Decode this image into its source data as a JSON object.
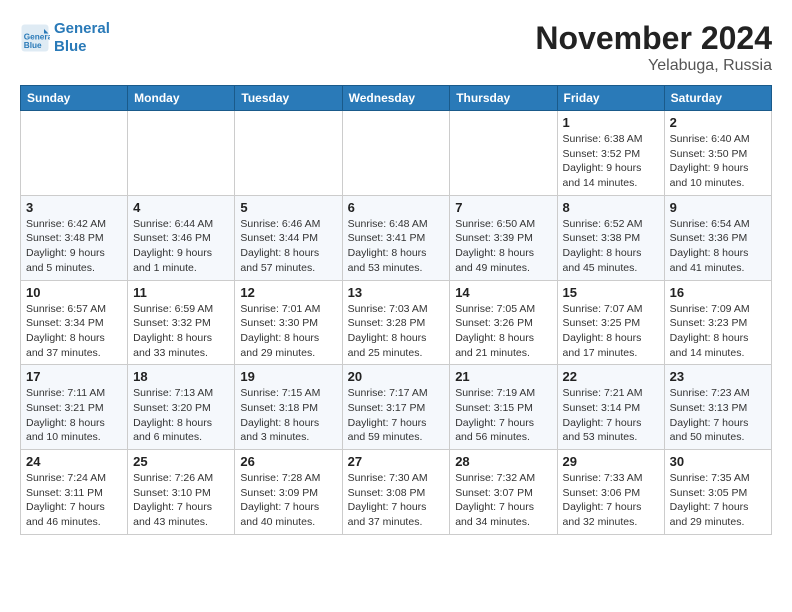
{
  "logo": {
    "line1": "General",
    "line2": "Blue"
  },
  "title": "November 2024",
  "location": "Yelabuga, Russia",
  "header": {
    "days": [
      "Sunday",
      "Monday",
      "Tuesday",
      "Wednesday",
      "Thursday",
      "Friday",
      "Saturday"
    ]
  },
  "weeks": [
    [
      {
        "day": "",
        "info": ""
      },
      {
        "day": "",
        "info": ""
      },
      {
        "day": "",
        "info": ""
      },
      {
        "day": "",
        "info": ""
      },
      {
        "day": "",
        "info": ""
      },
      {
        "day": "1",
        "info": "Sunrise: 6:38 AM\nSunset: 3:52 PM\nDaylight: 9 hours and 14 minutes."
      },
      {
        "day": "2",
        "info": "Sunrise: 6:40 AM\nSunset: 3:50 PM\nDaylight: 9 hours and 10 minutes."
      }
    ],
    [
      {
        "day": "3",
        "info": "Sunrise: 6:42 AM\nSunset: 3:48 PM\nDaylight: 9 hours and 5 minutes."
      },
      {
        "day": "4",
        "info": "Sunrise: 6:44 AM\nSunset: 3:46 PM\nDaylight: 9 hours and 1 minute."
      },
      {
        "day": "5",
        "info": "Sunrise: 6:46 AM\nSunset: 3:44 PM\nDaylight: 8 hours and 57 minutes."
      },
      {
        "day": "6",
        "info": "Sunrise: 6:48 AM\nSunset: 3:41 PM\nDaylight: 8 hours and 53 minutes."
      },
      {
        "day": "7",
        "info": "Sunrise: 6:50 AM\nSunset: 3:39 PM\nDaylight: 8 hours and 49 minutes."
      },
      {
        "day": "8",
        "info": "Sunrise: 6:52 AM\nSunset: 3:38 PM\nDaylight: 8 hours and 45 minutes."
      },
      {
        "day": "9",
        "info": "Sunrise: 6:54 AM\nSunset: 3:36 PM\nDaylight: 8 hours and 41 minutes."
      }
    ],
    [
      {
        "day": "10",
        "info": "Sunrise: 6:57 AM\nSunset: 3:34 PM\nDaylight: 8 hours and 37 minutes."
      },
      {
        "day": "11",
        "info": "Sunrise: 6:59 AM\nSunset: 3:32 PM\nDaylight: 8 hours and 33 minutes."
      },
      {
        "day": "12",
        "info": "Sunrise: 7:01 AM\nSunset: 3:30 PM\nDaylight: 8 hours and 29 minutes."
      },
      {
        "day": "13",
        "info": "Sunrise: 7:03 AM\nSunset: 3:28 PM\nDaylight: 8 hours and 25 minutes."
      },
      {
        "day": "14",
        "info": "Sunrise: 7:05 AM\nSunset: 3:26 PM\nDaylight: 8 hours and 21 minutes."
      },
      {
        "day": "15",
        "info": "Sunrise: 7:07 AM\nSunset: 3:25 PM\nDaylight: 8 hours and 17 minutes."
      },
      {
        "day": "16",
        "info": "Sunrise: 7:09 AM\nSunset: 3:23 PM\nDaylight: 8 hours and 14 minutes."
      }
    ],
    [
      {
        "day": "17",
        "info": "Sunrise: 7:11 AM\nSunset: 3:21 PM\nDaylight: 8 hours and 10 minutes."
      },
      {
        "day": "18",
        "info": "Sunrise: 7:13 AM\nSunset: 3:20 PM\nDaylight: 8 hours and 6 minutes."
      },
      {
        "day": "19",
        "info": "Sunrise: 7:15 AM\nSunset: 3:18 PM\nDaylight: 8 hours and 3 minutes."
      },
      {
        "day": "20",
        "info": "Sunrise: 7:17 AM\nSunset: 3:17 PM\nDaylight: 7 hours and 59 minutes."
      },
      {
        "day": "21",
        "info": "Sunrise: 7:19 AM\nSunset: 3:15 PM\nDaylight: 7 hours and 56 minutes."
      },
      {
        "day": "22",
        "info": "Sunrise: 7:21 AM\nSunset: 3:14 PM\nDaylight: 7 hours and 53 minutes."
      },
      {
        "day": "23",
        "info": "Sunrise: 7:23 AM\nSunset: 3:13 PM\nDaylight: 7 hours and 50 minutes."
      }
    ],
    [
      {
        "day": "24",
        "info": "Sunrise: 7:24 AM\nSunset: 3:11 PM\nDaylight: 7 hours and 46 minutes."
      },
      {
        "day": "25",
        "info": "Sunrise: 7:26 AM\nSunset: 3:10 PM\nDaylight: 7 hours and 43 minutes."
      },
      {
        "day": "26",
        "info": "Sunrise: 7:28 AM\nSunset: 3:09 PM\nDaylight: 7 hours and 40 minutes."
      },
      {
        "day": "27",
        "info": "Sunrise: 7:30 AM\nSunset: 3:08 PM\nDaylight: 7 hours and 37 minutes."
      },
      {
        "day": "28",
        "info": "Sunrise: 7:32 AM\nSunset: 3:07 PM\nDaylight: 7 hours and 34 minutes."
      },
      {
        "day": "29",
        "info": "Sunrise: 7:33 AM\nSunset: 3:06 PM\nDaylight: 7 hours and 32 minutes."
      },
      {
        "day": "30",
        "info": "Sunrise: 7:35 AM\nSunset: 3:05 PM\nDaylight: 7 hours and 29 minutes."
      }
    ]
  ]
}
